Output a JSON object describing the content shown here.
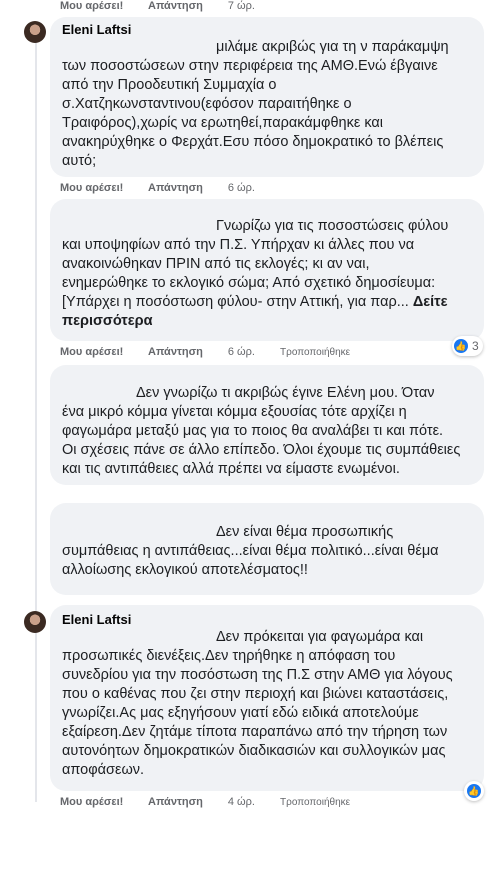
{
  "labels": {
    "like": "Μου αρέσει!",
    "reply": "Απάντηση",
    "edited": "Τροποποιήθηκε"
  },
  "comments": [
    {
      "time": "7 ώρ."
    },
    {
      "author": "Eleni Laftsi",
      "lines": [
        "μιλάμε ακριβώς για τη ν παράκαμψη",
        "των ποσοστώσεων στην περιφέρεια της ΑΜΘ.Ενώ έβγαινε",
        "από την Προοδευτική Συμμαχία ο",
        "σ.Χατζηκωνσταντινου(εφόσον παραιτήθηκε ο",
        "Τραιφόρος),χωρίς να ερωτηθεί,παρακάμφθηκε και",
        "ανακηρύχθηκε ο Φερχάτ.Εσυ πόσο δημοκρατικό το βλέπεις",
        "αυτό;"
      ],
      "time": "6 ώρ."
    },
    {
      "lines": [
        "Γνωρίζω για τις ποσοστώσεις φύλου",
        "και υποψηφίων από την Π.Σ. Υπήρχαν κι άλλες που να",
        "ανακοινώθηκαν ΠΡΙΝ από τις εκλογές; κι αν ναι,",
        "ενημερώθηκε το εκλογικό σώμα; Από σχετικό δημοσίευμα:",
        "[Υπάρχει η ποσόστωση φύλου- στην Αττική, για παρ..."
      ],
      "see_more": "Δείτε",
      "see_more_2": "περισσότερα",
      "time": "6 ώρ.",
      "edited": "Τροποποιήθηκε",
      "reactions": "3"
    },
    {
      "lines": [
        "Δεν γνωρίζω τι ακριβώς έγινε Ελένη μου. Όταν",
        "ένα μικρό κόμμα γίνεται κόμμα εξουσίας τότε αρχίζει η",
        "φαγωμάρα μεταξύ μας για το ποιος θα αναλάβει τι και πότε.",
        "Οι σχέσεις πάνε σε άλλο επίπεδο. Όλοι έχουμε τις συμπάθειες",
        "και τις αντιπάθειες αλλά πρέπει να είμαστε ενωμένοι."
      ]
    },
    {
      "lines": [
        "Δεν είναι θέμα προσωπικής",
        "συμπάθειας η αντιπάθειας...είναι θέμα πολιτικό...είναι θέμα",
        "αλλοίωσης εκλογικού αποτελέσματος!!"
      ]
    },
    {
      "author": "Eleni Laftsi",
      "lines": [
        "Δεν πρόκειται για φαγωμάρα και",
        "προσωπικές διενέξεις.Δεν τηρήθηκε η απόφαση του",
        "συνεδρίου για την ποσόστωση της Π.Σ στην ΑΜΘ για λόγους",
        "που ο καθένας που ζει στην περιοχή και βιώνει καταστάσεις,",
        "γνωρίζει.Ας μας εξηγήσουν γιατί εδώ ειδικά αποτελούμε",
        "εξαίρεση.Δεν ζητάμε τίποτα παραπάνω από την τήρηση των",
        "αυτονόητων δημοκρατικών διαδικασιών και συλλογικών μας",
        "αποφάσεων."
      ],
      "time": "4 ώρ.",
      "edited": "Τροποποιήθηκε",
      "reaction_icon": "like-icon"
    }
  ]
}
